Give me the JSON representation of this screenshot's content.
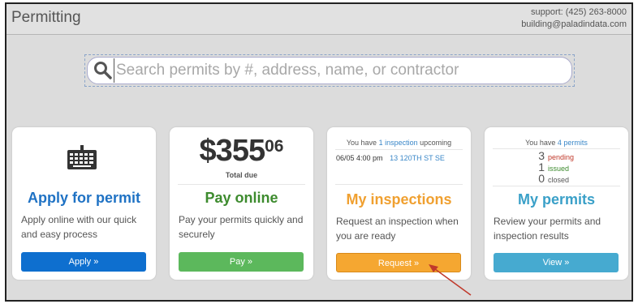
{
  "header": {
    "title": "Permitting",
    "support_phone": "support: (425) 263-8000",
    "support_email": "building@paladindata.com"
  },
  "search": {
    "placeholder": "Search permits by #, address, name, or contractor",
    "value": ""
  },
  "cards": {
    "apply": {
      "icon": "keyboard-icon",
      "heading": "Apply for permit",
      "description": "Apply online with our quick and easy process",
      "button": "Apply »",
      "color": "#1f72c4",
      "button_color": "#0e6fcf"
    },
    "pay": {
      "amount_dollars": "$355",
      "amount_cents": "06",
      "amount_caption": "Total due",
      "heading": "Pay online",
      "description": "Pay your permits quickly and securely",
      "button": "Pay »",
      "color": "#3d8b2e",
      "button_color": "#5cb85c"
    },
    "inspections": {
      "summary_prefix": "You have ",
      "summary_link": "1 inspection",
      "summary_suffix": " upcoming",
      "item_datetime": "06/05 4:00 pm",
      "item_address": "13 120TH ST SE",
      "heading": "My inspections",
      "description": "Request an inspection when you are ready",
      "button": "Request »",
      "color": "#f0a030",
      "button_color": "#f5a731"
    },
    "permits": {
      "summary_prefix": "You have ",
      "summary_link": "4 permits",
      "counts": [
        {
          "num": "3",
          "label": "pending",
          "color": "#c0392b"
        },
        {
          "num": "1",
          "label": "issued",
          "color": "#3d8b2e"
        },
        {
          "num": "0",
          "label": "closed",
          "color": "#555555"
        }
      ],
      "heading": "My permits",
      "description": "Review your permits and inspection results",
      "button": "View »",
      "color": "#3aa0c8",
      "button_color": "#46aad0"
    }
  }
}
